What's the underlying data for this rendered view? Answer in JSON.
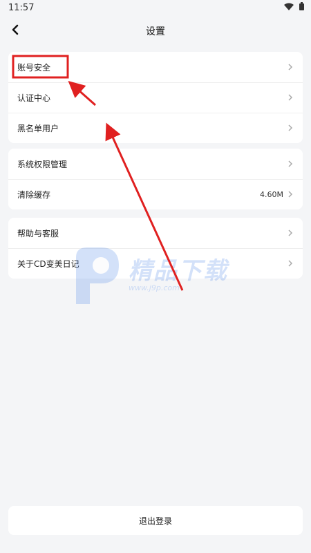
{
  "status_bar": {
    "time": "11:57",
    "icons": [
      "wifi-icon",
      "battery-icon"
    ]
  },
  "nav": {
    "title": "设置",
    "back_icon": "chevron-left-icon"
  },
  "groups": [
    {
      "items": [
        {
          "label": "账号安全",
          "highlighted": true
        },
        {
          "label": "认证中心"
        },
        {
          "label": "黑名单用户"
        }
      ]
    },
    {
      "items": [
        {
          "label": "系统权限管理"
        },
        {
          "label": "清除缓存",
          "value": "4.60M"
        }
      ]
    },
    {
      "items": [
        {
          "label": "帮助与客服"
        },
        {
          "label": "关于CD变美日记"
        }
      ]
    }
  ],
  "logout": {
    "label": "退出登录"
  },
  "annotations": {
    "highlight_color": "#e02020",
    "arrow_color": "#e02020"
  },
  "watermark": {
    "text": "精品下载",
    "url": "www.j9p.com"
  },
  "colors": {
    "background": "#f4f5f7",
    "card": "#ffffff",
    "divider": "#eeeeee",
    "chevron": "#aaaaaa"
  }
}
